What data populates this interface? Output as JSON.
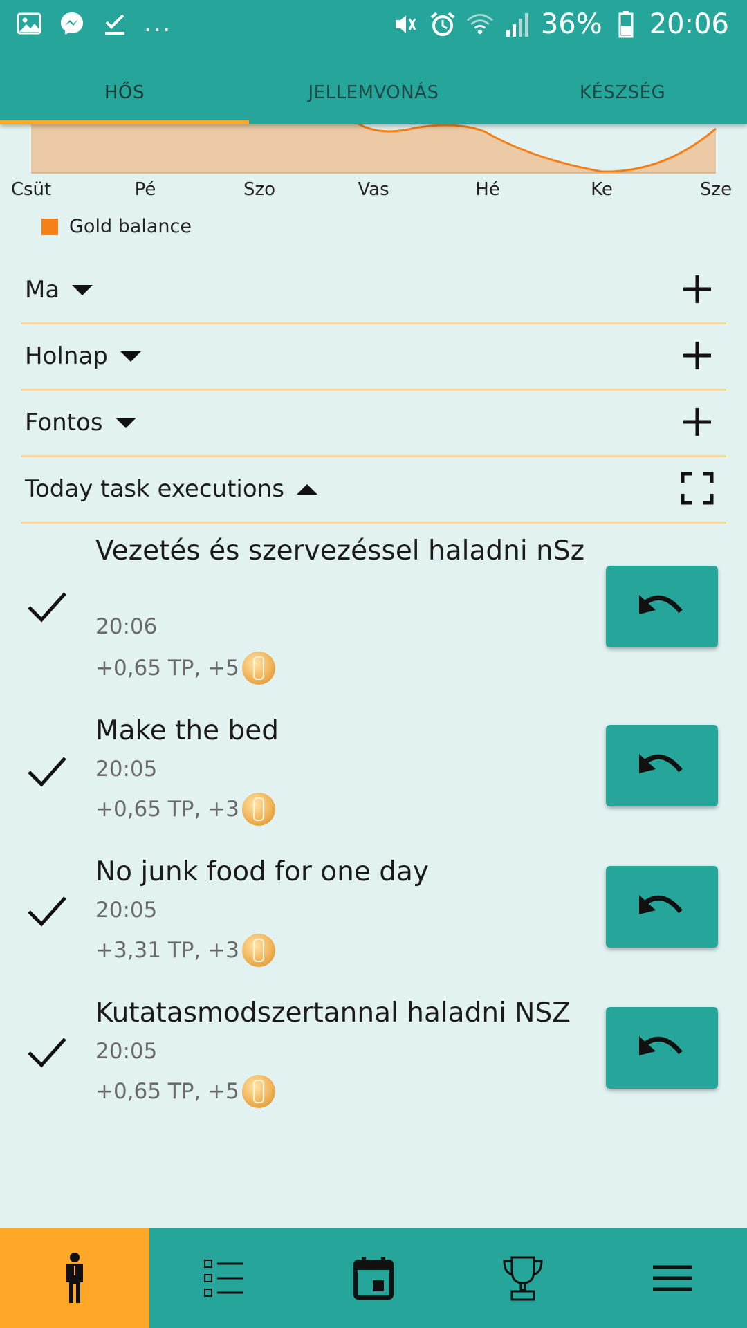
{
  "status_bar": {
    "time": "20:06",
    "battery": "36%",
    "overflow": "...",
    "icons": [
      "gallery-icon",
      "messenger-icon",
      "task-check-icon",
      "mute-icon",
      "alarm-icon",
      "wifi-icon",
      "signal-icon",
      "battery-icon"
    ]
  },
  "tabs": [
    {
      "label": "HŐS",
      "active": true
    },
    {
      "label": "JELLEMVONÁS",
      "active": false
    },
    {
      "label": "KÉSZSÉG",
      "active": false
    }
  ],
  "chart_data": {
    "type": "area",
    "categories": [
      "Csüt",
      "Pé",
      "Szo",
      "Vas",
      "Hé",
      "Ke",
      "Sze"
    ],
    "series": [
      {
        "name": "Gold balance",
        "color": "#f57f17"
      }
    ],
    "legend": "bottom-left"
  },
  "sections": [
    {
      "title": "Ma",
      "expanded": false,
      "action_icon": "plus-icon"
    },
    {
      "title": "Holnap",
      "expanded": false,
      "action_icon": "plus-icon"
    },
    {
      "title": "Fontos",
      "expanded": false,
      "action_icon": "plus-icon"
    },
    {
      "title": "Today task executions",
      "expanded": true,
      "action_icon": "fullscreen-icon"
    }
  ],
  "executions": [
    {
      "title": "Vezetés és szervezéssel haladni nSz",
      "time": "20:06",
      "reward": "+0,65 TP, +5"
    },
    {
      "title": "Make the bed",
      "time": "20:05",
      "reward": "+0,65 TP, +3"
    },
    {
      "title": "No junk food for one day",
      "time": "20:05",
      "reward": "+3,31 TP, +3"
    },
    {
      "title": "Kutatasmodszertannal haladni NSZ",
      "time": "20:05",
      "reward": "+0,65 TP, +5"
    }
  ],
  "bottom_nav": [
    {
      "icon": "hero-person-icon",
      "active": true
    },
    {
      "icon": "checklist-icon",
      "active": false
    },
    {
      "icon": "calendar-icon",
      "active": false
    },
    {
      "icon": "trophy-icon",
      "active": false
    },
    {
      "icon": "menu-icon",
      "active": false
    }
  ],
  "colors": {
    "primary": "#26a69a",
    "accent": "#ffa726",
    "chart_line": "#f57f17",
    "chart_fill": "#eccaa6",
    "background": "#e2f2f1",
    "divider": "#f3d9a2"
  }
}
